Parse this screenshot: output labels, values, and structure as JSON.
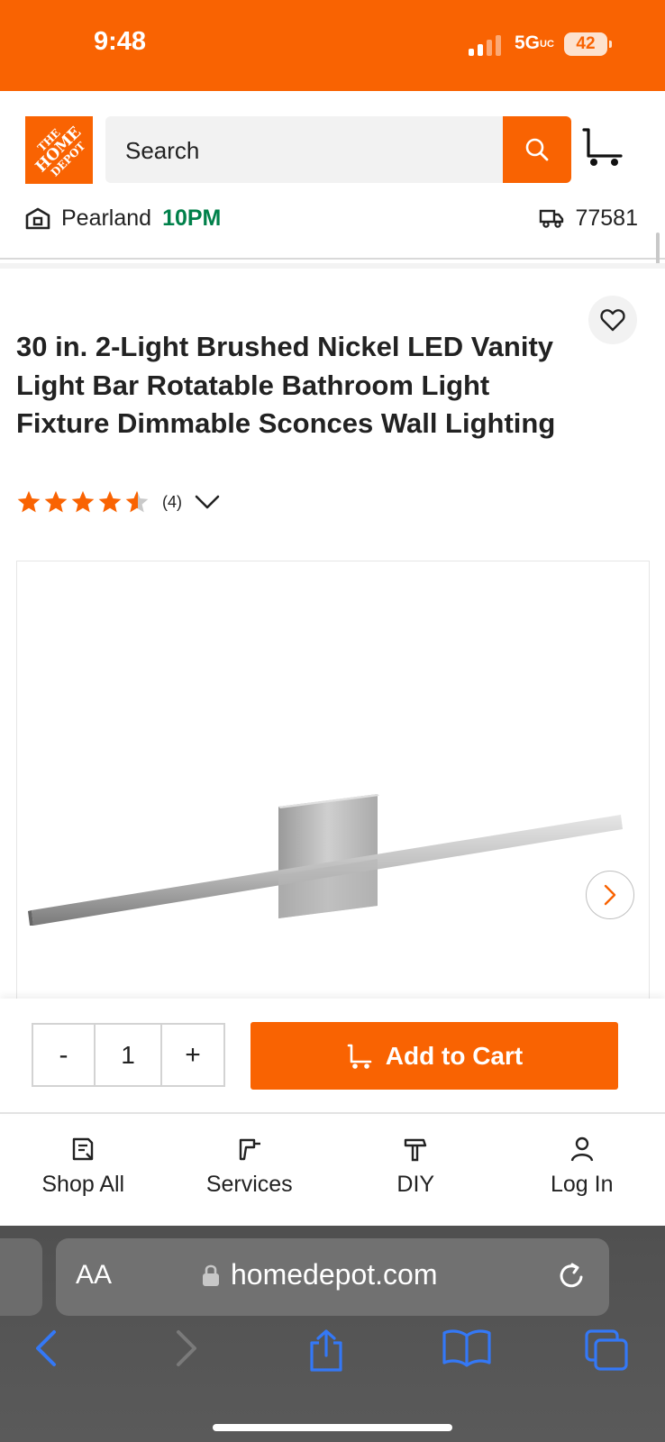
{
  "status_bar": {
    "time": "9:48",
    "network": "5G",
    "network_sup": "UC",
    "battery": "42"
  },
  "header": {
    "logo_lines": [
      "THE",
      "HOME",
      "DEPOT"
    ],
    "search_placeholder": "Search",
    "store_name": "Pearland",
    "store_hours": "10PM",
    "zip": "77581"
  },
  "product": {
    "title": "30 in. 2-Light Brushed Nickel LED Vanity Light Bar Rotatable Bathroom Light Fixture Dimmable Sconces Wall Lighting",
    "rating": 4.5,
    "review_count": "(4)"
  },
  "cart_bar": {
    "minus": "-",
    "quantity": "1",
    "plus": "+",
    "add_to_cart": "Add to Cart"
  },
  "bottom_nav": [
    {
      "label": "Shop All"
    },
    {
      "label": "Services"
    },
    {
      "label": "DIY"
    },
    {
      "label": "Log In"
    }
  ],
  "browser": {
    "text_size": "AA",
    "url": "homedepot.com"
  },
  "colors": {
    "brand": "#f96302",
    "store_open": "#00804a",
    "browser_blue": "#3478f6"
  }
}
